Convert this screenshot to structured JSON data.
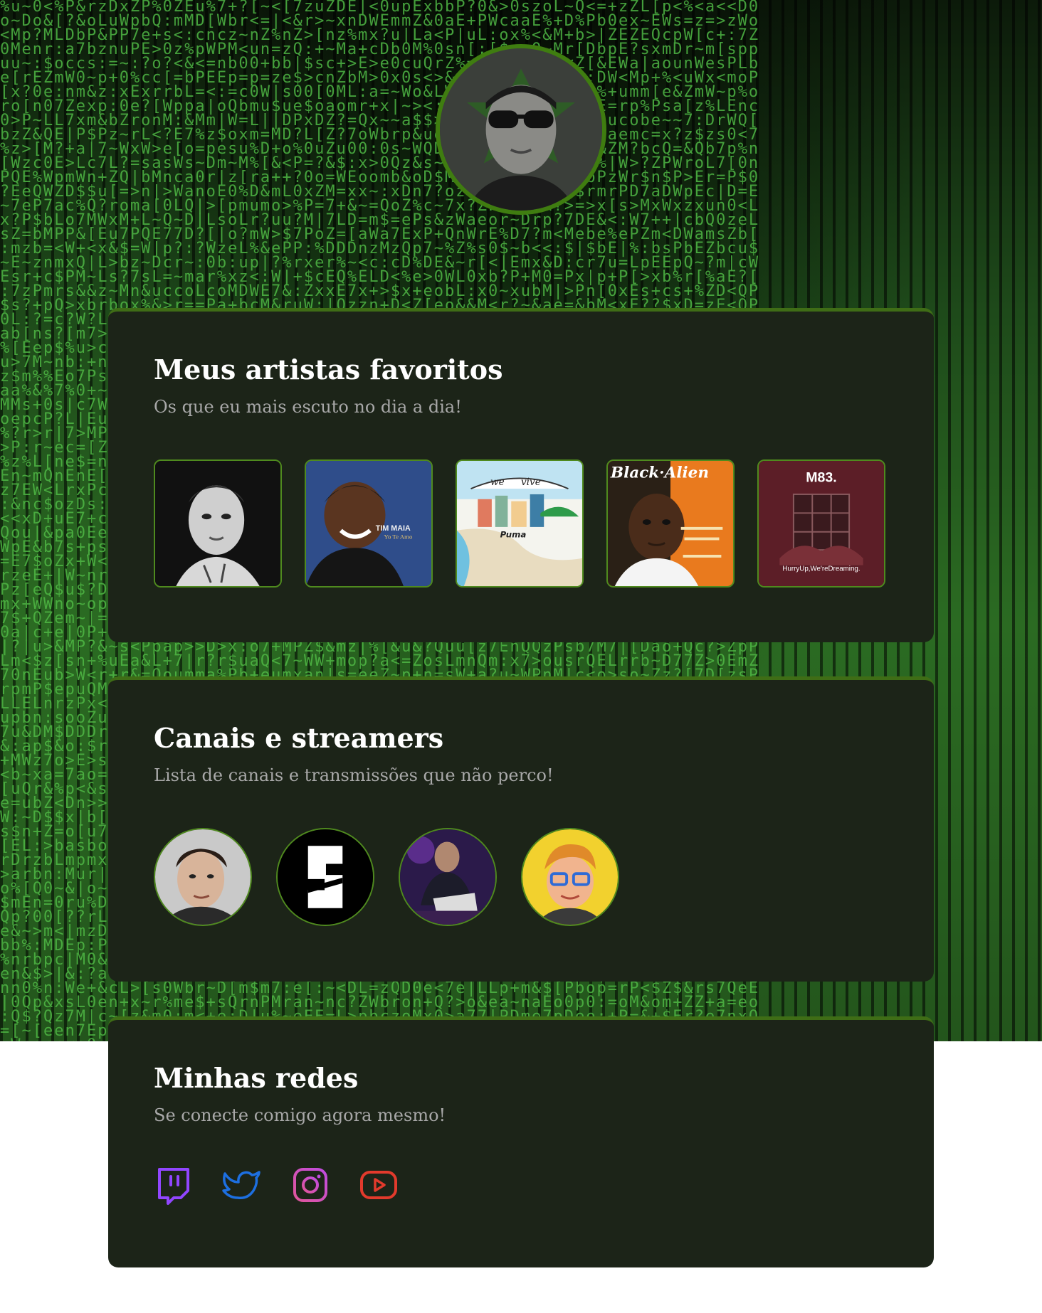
{
  "profile": {
    "avatar_icon": "profile-photo"
  },
  "artists_section": {
    "title": "Meus artistas favoritos",
    "subtitle": "Os que eu mais escuto no dia a dia!",
    "items": [
      {
        "icon": "lil-peep-album-cover"
      },
      {
        "icon": "tim-maia-album-cover",
        "cover_text_1": "TIM MAIA",
        "cover_text_2": "Yo Te Amo"
      },
      {
        "icon": "we-vive-album-cover",
        "cover_text_1": "we",
        "cover_text_2": "vive",
        "cover_text_3": "Puma"
      },
      {
        "icon": "black-alien-album-cover",
        "cover_text_1": "Black·Alien"
      },
      {
        "icon": "m83-album-cover",
        "cover_text_1": "M83.",
        "cover_text_2": "HurryUp,We'reDreaming."
      }
    ]
  },
  "streamers_section": {
    "title": "Canais e streamers",
    "subtitle": "Lista de canais e transmissões que não perco!",
    "items": [
      {
        "icon": "streamer-avatar-1"
      },
      {
        "icon": "streamer-avatar-2"
      },
      {
        "icon": "streamer-avatar-3"
      },
      {
        "icon": "streamer-avatar-4"
      }
    ]
  },
  "networks_section": {
    "title": "Minhas redes",
    "subtitle": "Se conecte comigo agora mesmo!",
    "items": [
      {
        "icon": "twitch-icon",
        "color": "#9146ff"
      },
      {
        "icon": "twitter-icon",
        "color": "#1d6fe0"
      },
      {
        "icon": "instagram-icon",
        "color": "#d04bd6"
      },
      {
        "icon": "youtube-icon",
        "color": "#e23a2c"
      }
    ]
  },
  "colors": {
    "card_background": "#1c2418",
    "card_border": "#3f6d16",
    "avatar_border": "#3f7d10",
    "title": "#ffffff",
    "subtitle": "#a8a8a8"
  }
}
